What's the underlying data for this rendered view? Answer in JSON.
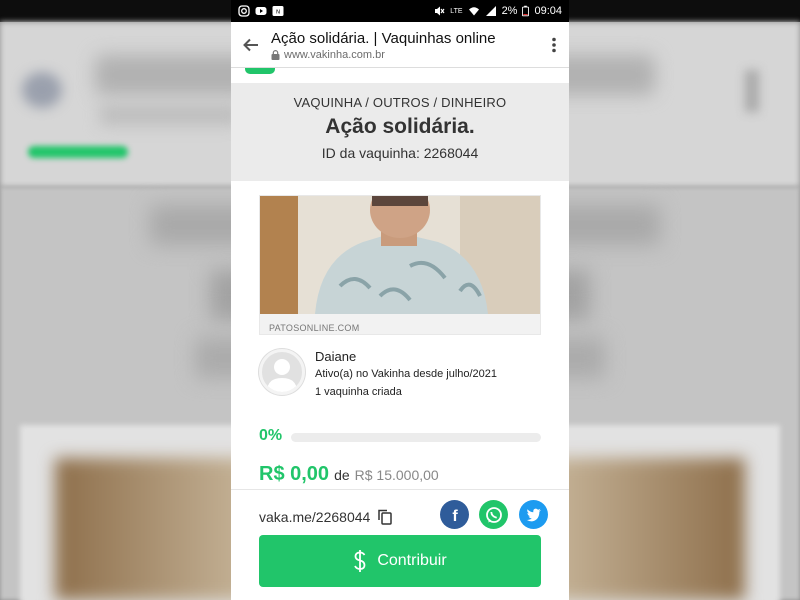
{
  "statusbar": {
    "network": "LTE",
    "battery": "2%",
    "time": "09:04"
  },
  "browser": {
    "title": "Ação solidária. | Vaquinhas online",
    "url": "www.vakinha.com.br"
  },
  "campaign": {
    "breadcrumb": "VAQUINHA / OUTROS / DINHEIRO",
    "title": "Ação solidária.",
    "id_text": "ID da vaquinha: 2268044"
  },
  "preview": {
    "source": "PATOSONLINE.COM"
  },
  "creator": {
    "name": "Daiane",
    "since": "Ativo(a) no Vakinha desde julho/2021",
    "count": "1 vaquinha criada"
  },
  "progress": {
    "percent_label": "0%",
    "fraction": 0
  },
  "amounts": {
    "raised": "R$ 0,00",
    "connector": "de",
    "goal": "R$ 15.000,00"
  },
  "share": {
    "short_url": "vaka.me/2268044"
  },
  "actions": {
    "contribute": "Contribuir"
  },
  "colors": {
    "brand_green": "#21c56a",
    "facebook": "#2f5c9a",
    "twitter": "#1d9bf0"
  },
  "icons": [
    "instagram-icon",
    "youtube-icon",
    "nfc-icon",
    "mute-icon",
    "wifi-icon",
    "signal-icon",
    "battery-icon",
    "back-arrow-icon",
    "lock-icon",
    "more-vert-icon",
    "copy-icon",
    "facebook-icon",
    "whatsapp-icon",
    "twitter-icon",
    "dollar-icon"
  ]
}
